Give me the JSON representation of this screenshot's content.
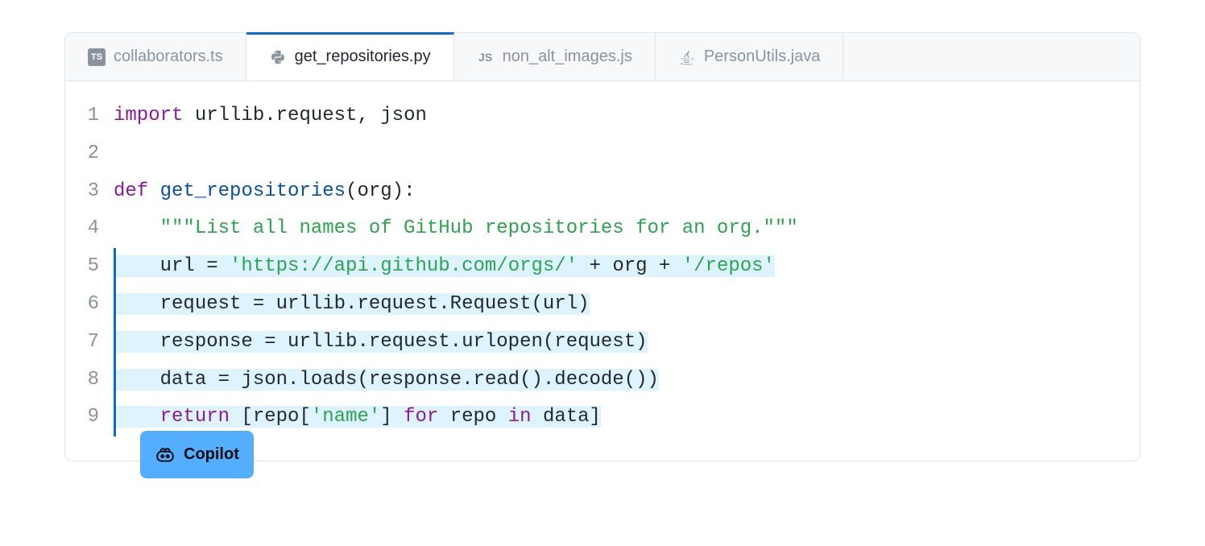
{
  "tabs": [
    {
      "label": "collaborators.ts",
      "lang": "ts",
      "active": false
    },
    {
      "label": "get_repositories.py",
      "lang": "py",
      "active": true
    },
    {
      "label": "non_alt_images.js",
      "lang": "js",
      "active": false
    },
    {
      "label": "PersonUtils.java",
      "lang": "java",
      "active": false
    }
  ],
  "badge": {
    "label": "Copilot"
  },
  "code": {
    "lines": [
      {
        "n": "1",
        "highlighted": false,
        "tokens": [
          {
            "t": "import",
            "c": "kw"
          },
          {
            "t": " urllib.request, json",
            "c": "nm"
          }
        ]
      },
      {
        "n": "2",
        "highlighted": false,
        "tokens": [
          {
            "t": " ",
            "c": "nm"
          }
        ]
      },
      {
        "n": "3",
        "highlighted": false,
        "tokens": [
          {
            "t": "def",
            "c": "kw"
          },
          {
            "t": " ",
            "c": "nm"
          },
          {
            "t": "get_repositories",
            "c": "fn"
          },
          {
            "t": "(org):",
            "c": "nm"
          }
        ]
      },
      {
        "n": "4",
        "highlighted": false,
        "tokens": [
          {
            "t": "    ",
            "c": "nm"
          },
          {
            "t": "\"\"\"List all names of GitHub repositories for an org.\"\"\"",
            "c": "str"
          }
        ]
      },
      {
        "n": "5",
        "highlighted": true,
        "tokens": [
          {
            "t": "    url = ",
            "c": "nm"
          },
          {
            "t": "'https://api.github.com/orgs/'",
            "c": "str"
          },
          {
            "t": " + org + ",
            "c": "nm"
          },
          {
            "t": "'/repos'",
            "c": "str"
          }
        ]
      },
      {
        "n": "6",
        "highlighted": true,
        "tokens": [
          {
            "t": "    request = urllib.request.Request(url)",
            "c": "nm"
          }
        ]
      },
      {
        "n": "7",
        "highlighted": true,
        "tokens": [
          {
            "t": "    response = urllib.request.urlopen(request)",
            "c": "nm"
          }
        ]
      },
      {
        "n": "8",
        "highlighted": true,
        "tokens": [
          {
            "t": "    data = json.loads(response.read().decode())",
            "c": "nm"
          }
        ]
      },
      {
        "n": "9",
        "highlighted": true,
        "tokens": [
          {
            "t": "    ",
            "c": "nm"
          },
          {
            "t": "return",
            "c": "kw"
          },
          {
            "t": " [repo[",
            "c": "nm"
          },
          {
            "t": "'name'",
            "c": "str"
          },
          {
            "t": "] ",
            "c": "nm"
          },
          {
            "t": "for",
            "c": "kw"
          },
          {
            "t": " repo ",
            "c": "nm"
          },
          {
            "t": "in",
            "c": "kw"
          },
          {
            "t": " data]",
            "c": "nm"
          }
        ]
      }
    ]
  }
}
